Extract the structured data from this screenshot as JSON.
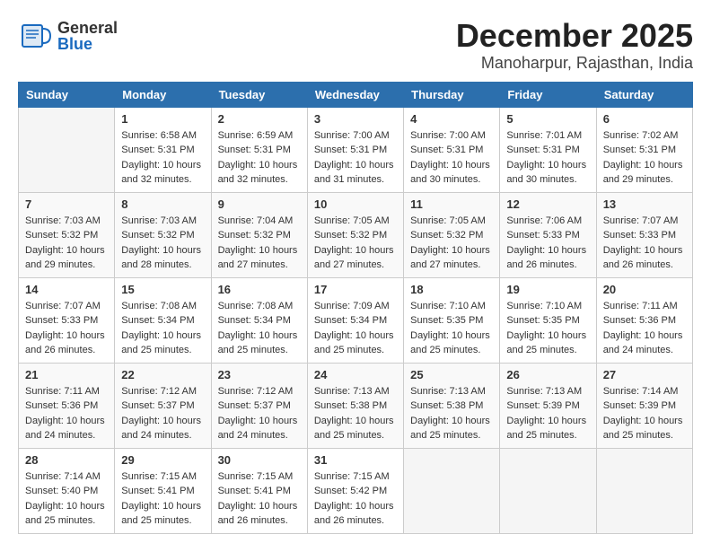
{
  "header": {
    "logo_general": "General",
    "logo_blue": "Blue",
    "month_title": "December 2025",
    "location": "Manoharpur, Rajasthan, India"
  },
  "days_of_week": [
    "Sunday",
    "Monday",
    "Tuesday",
    "Wednesday",
    "Thursday",
    "Friday",
    "Saturday"
  ],
  "weeks": [
    [
      {
        "day": "",
        "info": ""
      },
      {
        "day": "1",
        "info": "Sunrise: 6:58 AM\nSunset: 5:31 PM\nDaylight: 10 hours\nand 32 minutes."
      },
      {
        "day": "2",
        "info": "Sunrise: 6:59 AM\nSunset: 5:31 PM\nDaylight: 10 hours\nand 32 minutes."
      },
      {
        "day": "3",
        "info": "Sunrise: 7:00 AM\nSunset: 5:31 PM\nDaylight: 10 hours\nand 31 minutes."
      },
      {
        "day": "4",
        "info": "Sunrise: 7:00 AM\nSunset: 5:31 PM\nDaylight: 10 hours\nand 30 minutes."
      },
      {
        "day": "5",
        "info": "Sunrise: 7:01 AM\nSunset: 5:31 PM\nDaylight: 10 hours\nand 30 minutes."
      },
      {
        "day": "6",
        "info": "Sunrise: 7:02 AM\nSunset: 5:31 PM\nDaylight: 10 hours\nand 29 minutes."
      }
    ],
    [
      {
        "day": "7",
        "info": "Sunrise: 7:03 AM\nSunset: 5:32 PM\nDaylight: 10 hours\nand 29 minutes."
      },
      {
        "day": "8",
        "info": "Sunrise: 7:03 AM\nSunset: 5:32 PM\nDaylight: 10 hours\nand 28 minutes."
      },
      {
        "day": "9",
        "info": "Sunrise: 7:04 AM\nSunset: 5:32 PM\nDaylight: 10 hours\nand 27 minutes."
      },
      {
        "day": "10",
        "info": "Sunrise: 7:05 AM\nSunset: 5:32 PM\nDaylight: 10 hours\nand 27 minutes."
      },
      {
        "day": "11",
        "info": "Sunrise: 7:05 AM\nSunset: 5:32 PM\nDaylight: 10 hours\nand 27 minutes."
      },
      {
        "day": "12",
        "info": "Sunrise: 7:06 AM\nSunset: 5:33 PM\nDaylight: 10 hours\nand 26 minutes."
      },
      {
        "day": "13",
        "info": "Sunrise: 7:07 AM\nSunset: 5:33 PM\nDaylight: 10 hours\nand 26 minutes."
      }
    ],
    [
      {
        "day": "14",
        "info": "Sunrise: 7:07 AM\nSunset: 5:33 PM\nDaylight: 10 hours\nand 26 minutes."
      },
      {
        "day": "15",
        "info": "Sunrise: 7:08 AM\nSunset: 5:34 PM\nDaylight: 10 hours\nand 25 minutes."
      },
      {
        "day": "16",
        "info": "Sunrise: 7:08 AM\nSunset: 5:34 PM\nDaylight: 10 hours\nand 25 minutes."
      },
      {
        "day": "17",
        "info": "Sunrise: 7:09 AM\nSunset: 5:34 PM\nDaylight: 10 hours\nand 25 minutes."
      },
      {
        "day": "18",
        "info": "Sunrise: 7:10 AM\nSunset: 5:35 PM\nDaylight: 10 hours\nand 25 minutes."
      },
      {
        "day": "19",
        "info": "Sunrise: 7:10 AM\nSunset: 5:35 PM\nDaylight: 10 hours\nand 25 minutes."
      },
      {
        "day": "20",
        "info": "Sunrise: 7:11 AM\nSunset: 5:36 PM\nDaylight: 10 hours\nand 24 minutes."
      }
    ],
    [
      {
        "day": "21",
        "info": "Sunrise: 7:11 AM\nSunset: 5:36 PM\nDaylight: 10 hours\nand 24 minutes."
      },
      {
        "day": "22",
        "info": "Sunrise: 7:12 AM\nSunset: 5:37 PM\nDaylight: 10 hours\nand 24 minutes."
      },
      {
        "day": "23",
        "info": "Sunrise: 7:12 AM\nSunset: 5:37 PM\nDaylight: 10 hours\nand 24 minutes."
      },
      {
        "day": "24",
        "info": "Sunrise: 7:13 AM\nSunset: 5:38 PM\nDaylight: 10 hours\nand 25 minutes."
      },
      {
        "day": "25",
        "info": "Sunrise: 7:13 AM\nSunset: 5:38 PM\nDaylight: 10 hours\nand 25 minutes."
      },
      {
        "day": "26",
        "info": "Sunrise: 7:13 AM\nSunset: 5:39 PM\nDaylight: 10 hours\nand 25 minutes."
      },
      {
        "day": "27",
        "info": "Sunrise: 7:14 AM\nSunset: 5:39 PM\nDaylight: 10 hours\nand 25 minutes."
      }
    ],
    [
      {
        "day": "28",
        "info": "Sunrise: 7:14 AM\nSunset: 5:40 PM\nDaylight: 10 hours\nand 25 minutes."
      },
      {
        "day": "29",
        "info": "Sunrise: 7:15 AM\nSunset: 5:41 PM\nDaylight: 10 hours\nand 25 minutes."
      },
      {
        "day": "30",
        "info": "Sunrise: 7:15 AM\nSunset: 5:41 PM\nDaylight: 10 hours\nand 26 minutes."
      },
      {
        "day": "31",
        "info": "Sunrise: 7:15 AM\nSunset: 5:42 PM\nDaylight: 10 hours\nand 26 minutes."
      },
      {
        "day": "",
        "info": ""
      },
      {
        "day": "",
        "info": ""
      },
      {
        "day": "",
        "info": ""
      }
    ]
  ]
}
